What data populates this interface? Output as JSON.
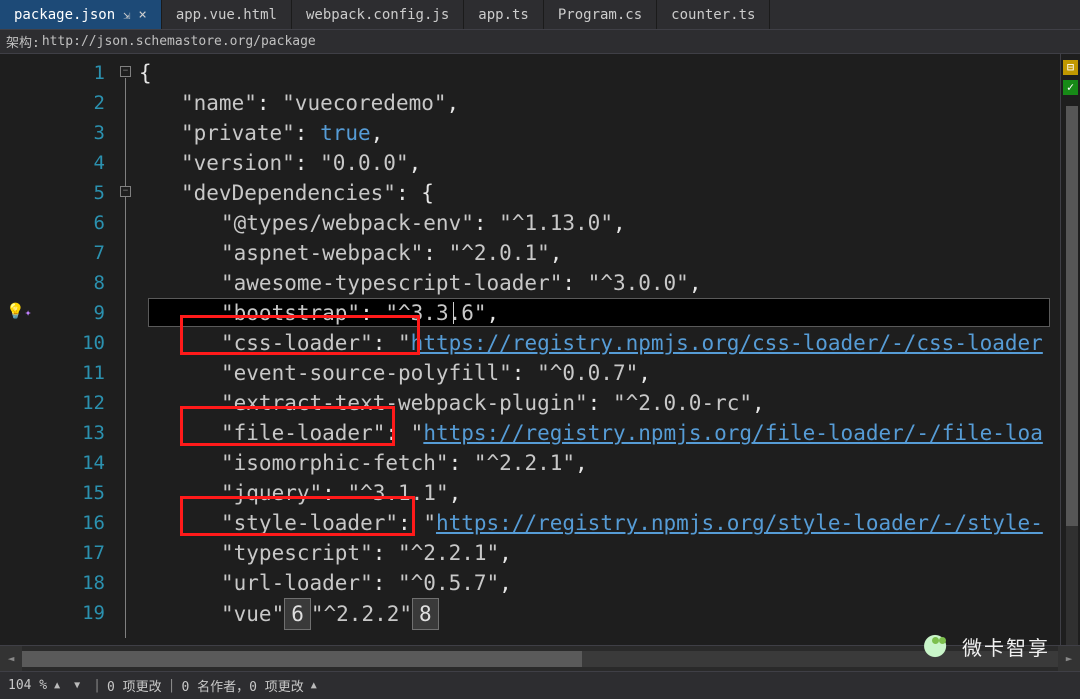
{
  "tabs": [
    {
      "label": "package.json",
      "active": true,
      "pinned": true
    },
    {
      "label": "app.vue.html",
      "active": false
    },
    {
      "label": "webpack.config.js",
      "active": false
    },
    {
      "label": "app.ts",
      "active": false
    },
    {
      "label": "Program.cs",
      "active": false
    },
    {
      "label": "counter.ts",
      "active": false
    }
  ],
  "navbar": {
    "label": "架构:",
    "url": "http://json.schemastore.org/package"
  },
  "zoom": "104 %",
  "status": {
    "changes": "0 项更改",
    "authors": "0 名作者，0 项更改"
  },
  "line_numbers": [
    "1",
    "2",
    "3",
    "4",
    "5",
    "6",
    "7",
    "8",
    "9",
    "10",
    "11",
    "12",
    "13",
    "14",
    "15",
    "16",
    "17",
    "18",
    "19"
  ],
  "code": {
    "open": "{",
    "name_key": "\"name\"",
    "name_val": "\"vuecoredemo\"",
    "private_key": "\"private\"",
    "private_val": "true",
    "version_key": "\"version\"",
    "version_val": "\"0.0.0\"",
    "dev_key": "\"devDependencies\"",
    "open2": "{",
    "d1_key": "\"@types/webpack-env\"",
    "d1_val": "\"^1.13.0\"",
    "d2_key": "\"aspnet-webpack\"",
    "d2_val": "\"^2.0.1\"",
    "d3_key": "\"awesome-typescript-loader\"",
    "d3_val": "\"^3.0.0\"",
    "d4_key": "\"bootstrap\"",
    "d4_val": "\"^3.3.6\"",
    "d5_key": "\"css-loader\"",
    "d5_link": "https://registry.npmjs.org/css-loader/-/css-loader",
    "d6_key": "\"event-source-polyfill\"",
    "d6_val": "\"^0.0.7\"",
    "d7_key": "\"extract-text-webpack-plugin\"",
    "d7_val": "\"^2.0.0-rc\"",
    "d8_key": "\"file-loader\"",
    "d8_link": "https://registry.npmjs.org/file-loader/-/file-loa",
    "d9_key": "\"isomorphic-fetch\"",
    "d9_val": "\"^2.2.1\"",
    "d10_key": "\"jquery\"",
    "d10_val": "\"^3.1.1\"",
    "d11_key": "\"style-loader\"",
    "d11_link": "https://registry.npmjs.org/style-loader/-/style-",
    "d12_key": "\"typescript\"",
    "d12_val": "\"^2.2.1\"",
    "d13_key": "\"url-loader\"",
    "d13_val": "\"^0.5.7\"",
    "vue_key": "\"vue\"",
    "vue_val": "\"^2.2.2\"",
    "rename1": "6",
    "rename2": "8"
  },
  "watermark": "微卡智享"
}
